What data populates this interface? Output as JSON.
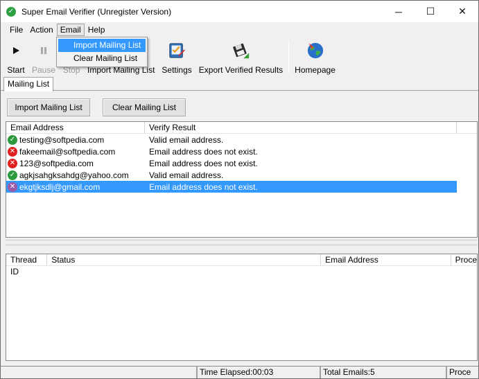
{
  "window": {
    "title": "Super Email Verifier (Unregister Version)",
    "controls": {
      "minimize": "─",
      "maximize": "☐",
      "close": "✕"
    }
  },
  "menubar": {
    "items": [
      "File",
      "Action",
      "Email",
      "Help"
    ],
    "open_menu": "Email",
    "email_menu": {
      "items": [
        "Import Mailing List",
        "Clear Mailing List"
      ],
      "highlighted": "Import Mailing List"
    }
  },
  "toolbar": {
    "buttons": [
      {
        "label": "Start",
        "icon": "play-icon",
        "enabled": true
      },
      {
        "label": "Pause",
        "icon": "pause-icon",
        "enabled": false
      },
      {
        "label": "Stop",
        "icon": "stop-icon",
        "enabled": false
      },
      {
        "label": "Import Mailing List",
        "icon": "import-icon",
        "enabled": true
      },
      {
        "label": "Settings",
        "icon": "settings-icon",
        "enabled": true
      },
      {
        "label": "Export Verified Results",
        "icon": "floppy-export-icon",
        "enabled": true
      },
      {
        "label": "Homepage",
        "icon": "globe-icon",
        "enabled": true
      }
    ]
  },
  "tabs": [
    "Mailing List"
  ],
  "actions": {
    "import": "Import Mailing List",
    "clear": "Clear Mailing List"
  },
  "email_table": {
    "columns": [
      "Email Address",
      "Verify Result"
    ],
    "rows": [
      {
        "email": "testing@softpedia.com",
        "result": "Valid email address.",
        "status": "valid"
      },
      {
        "email": "fakeemail@softpedia.com",
        "result": "Email address does not exist.",
        "status": "invalid"
      },
      {
        "email": "123@softpedia.com",
        "result": "Email address does not exist.",
        "status": "invalid"
      },
      {
        "email": "agkjsahgksahdg@yahoo.com",
        "result": "Valid email address.",
        "status": "valid"
      },
      {
        "email": "ekgtjksdlj@gmail.com",
        "result": "Email address does not exist.",
        "status": "invalid",
        "selected": true
      }
    ]
  },
  "thread_table": {
    "columns": [
      "Thread ID",
      "Status",
      "Email Address",
      "Proce"
    ]
  },
  "statusbar": {
    "time_elapsed": "Time Elapsed:00:03",
    "total_emails": "Total Emails:5",
    "process": "Proce"
  },
  "colors": {
    "selection": "#3399ff",
    "valid": "#2e9a3e",
    "invalid": "#e02020"
  }
}
